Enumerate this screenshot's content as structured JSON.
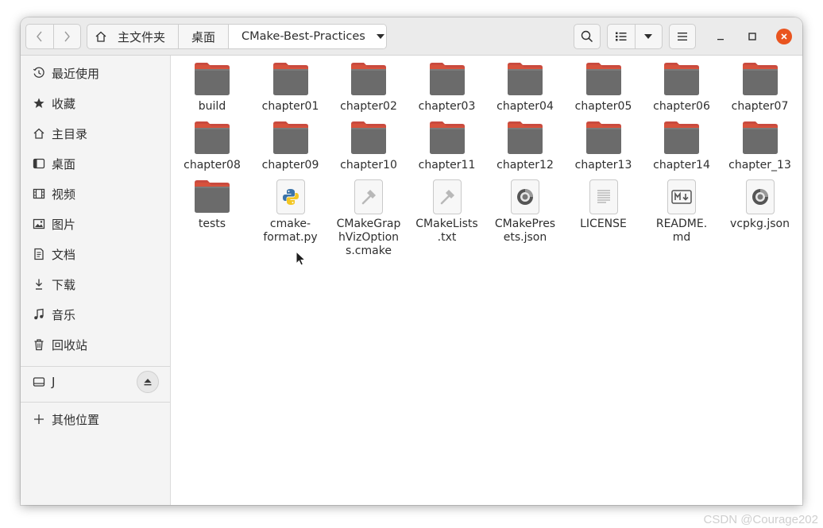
{
  "window": {
    "breadcrumbs": [
      "主文件夹",
      "桌面",
      "CMake-Best-Practices"
    ]
  },
  "sidebar": {
    "places": [
      {
        "label": "最近使用",
        "icon": "clock-icon"
      },
      {
        "label": "收藏",
        "icon": "star-icon"
      },
      {
        "label": "主目录",
        "icon": "home-icon"
      },
      {
        "label": "桌面",
        "icon": "desktop-icon"
      },
      {
        "label": "视频",
        "icon": "video-icon"
      },
      {
        "label": "图片",
        "icon": "image-icon"
      },
      {
        "label": "文档",
        "icon": "document-icon"
      },
      {
        "label": "下载",
        "icon": "download-icon"
      },
      {
        "label": "音乐",
        "icon": "music-icon"
      },
      {
        "label": "回收站",
        "icon": "trash-icon"
      }
    ],
    "drive": {
      "label": "J",
      "icon": "drive-icon"
    },
    "other": {
      "label": "其他位置",
      "icon": "plus-icon"
    }
  },
  "files": [
    {
      "name": "build",
      "type": "folder"
    },
    {
      "name": "chapter01",
      "type": "folder"
    },
    {
      "name": "chapter02",
      "type": "folder"
    },
    {
      "name": "chapter03",
      "type": "folder"
    },
    {
      "name": "chapter04",
      "type": "folder"
    },
    {
      "name": "chapter05",
      "type": "folder"
    },
    {
      "name": "chapter06",
      "type": "folder"
    },
    {
      "name": "chapter07",
      "type": "folder"
    },
    {
      "name": "chapter08",
      "type": "folder"
    },
    {
      "name": "chapter09",
      "type": "folder"
    },
    {
      "name": "chapter10",
      "type": "folder"
    },
    {
      "name": "chapter11",
      "type": "folder"
    },
    {
      "name": "chapter12",
      "type": "folder"
    },
    {
      "name": "chapter13",
      "type": "folder"
    },
    {
      "name": "chapter14",
      "type": "folder"
    },
    {
      "name": "chapter_13",
      "type": "folder"
    },
    {
      "name": "tests",
      "type": "folder"
    },
    {
      "name": "cmake-format.py",
      "display": "cmake-\nformat.py",
      "type": "python"
    },
    {
      "name": "CMakeGraphVizOptions.cmake",
      "display": "CMakeGrap\nhVizOption\ns.cmake",
      "type": "cmake"
    },
    {
      "name": "CMakeLists.txt",
      "display": "CMakeLists\n.txt",
      "type": "cmake"
    },
    {
      "name": "CMakePresets.json",
      "display": "CMakePres\nets.json",
      "type": "json"
    },
    {
      "name": "LICENSE",
      "type": "text"
    },
    {
      "name": "README.md",
      "display": "README.\nmd",
      "type": "markdown"
    },
    {
      "name": "vcpkg.json",
      "type": "json"
    }
  ],
  "watermark": "CSDN @Courage202",
  "colors": {
    "folder_tab": "#c94a3e",
    "folder_body": "#6b6b6b",
    "close_button": "#e9541f",
    "header_bg": "#ebebeb",
    "sidebar_bg": "#f4f4f4"
  }
}
